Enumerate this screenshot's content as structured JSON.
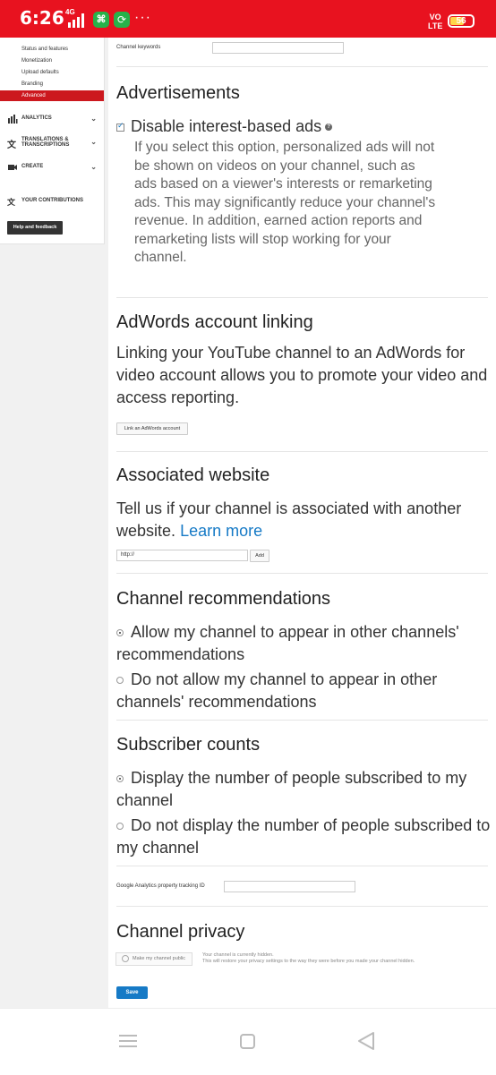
{
  "status_bar": {
    "time": "6:26",
    "network": "4G",
    "volte": "VO\nLTE",
    "battery": "56",
    "more": "···"
  },
  "sidebar": {
    "sub_items": [
      "Status and features",
      "Monetization",
      "Upload defaults",
      "Branding"
    ],
    "active_item": "Advanced",
    "nav_items": [
      {
        "label": "ANALYTICS",
        "icon": "analytics-icon"
      },
      {
        "label": "TRANSLATIONS &\nTRANSCRIPTIONS",
        "icon": "translate-icon"
      },
      {
        "label": "CREATE",
        "icon": "video-camera-icon"
      },
      {
        "label": "YOUR CONTRIBUTIONS",
        "icon": "contributions-icon"
      }
    ],
    "help_button": "Help and feedback"
  },
  "main": {
    "channel_keywords_label": "Channel keywords",
    "advertisements": {
      "title": "Advertisements",
      "checkbox_label": "Disable interest-based ads",
      "description": "If you select this option, personalized ads will not be shown on videos on your channel, such as ads based on a viewer's interests or remarketing ads. This may significantly reduce your channel's revenue. In addition, earned action reports and remarketing lists will stop working for your channel."
    },
    "adwords": {
      "title": "AdWords account linking",
      "description": "Linking your YouTube channel to an AdWords for video account allows you to promote your video and access reporting.",
      "button": "Link an AdWords account"
    },
    "associated_website": {
      "title": "Associated website",
      "description": "Tell us if your channel is associated with another website.",
      "learn_more": "Learn more",
      "input_value": "http://",
      "add_button": "Add"
    },
    "recommendations": {
      "title": "Channel recommendations",
      "options": [
        "Allow my channel to appear in other channels' recommendations",
        "Do not allow my channel to appear in other channels' recommendations"
      ],
      "selected": 0
    },
    "subscriber_counts": {
      "title": "Subscriber counts",
      "options": [
        "Display the number of people subscribed to my channel",
        "Do not display the number of people subscribed to my channel"
      ],
      "selected": 0
    },
    "analytics_label": "Google Analytics property tracking ID",
    "privacy": {
      "title": "Channel privacy",
      "button": "Make my channel public",
      "note_line1": "Your channel is currently hidden.",
      "note_line2": "This will restore your privacy settings to the way they were before you made your channel hidden."
    },
    "save_button": "Save"
  },
  "colors": {
    "status_bar": "#e8121f",
    "active_nav": "#cc181e",
    "link": "#167ac6",
    "save_button": "#167ac6"
  }
}
